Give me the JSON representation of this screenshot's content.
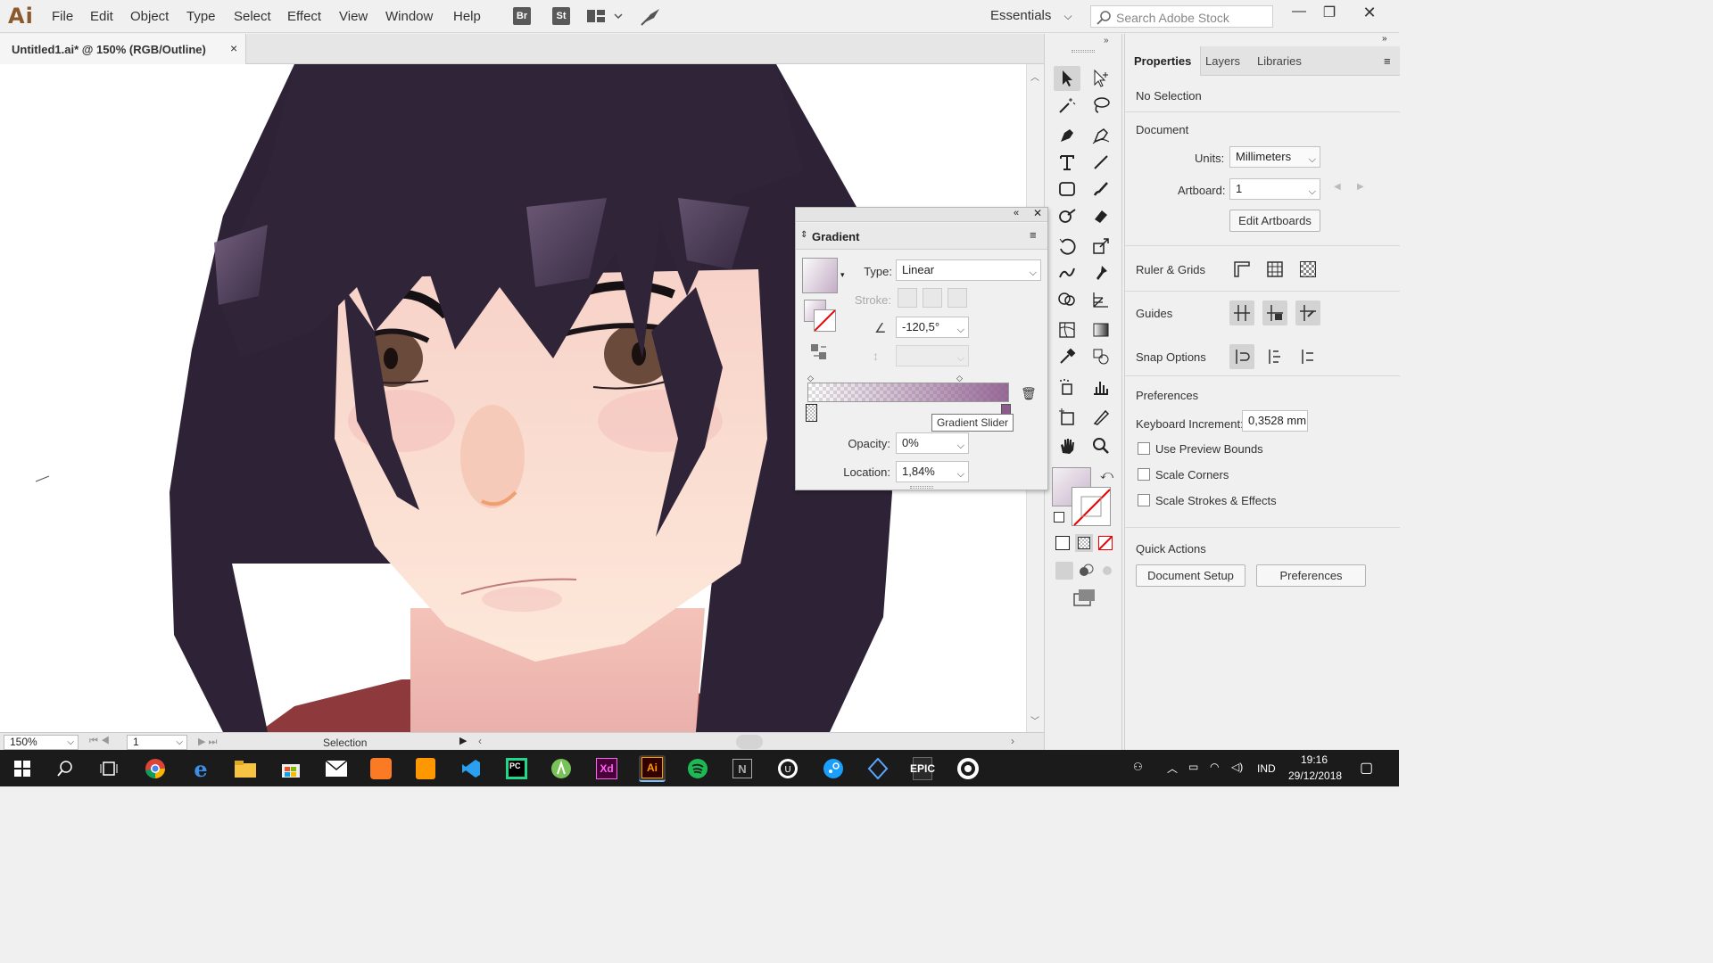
{
  "app": {
    "logo": "Ai",
    "menu": [
      "File",
      "Edit",
      "Object",
      "Type",
      "Select",
      "Effect",
      "View",
      "Window",
      "Help"
    ],
    "bridge_buttons": [
      "Br",
      "St"
    ],
    "workspace": "Essentials",
    "stock_search_placeholder": "Search Adobe Stock"
  },
  "document": {
    "tab_title": "Untitled1.ai* @ 150% (RGB/Outline)",
    "tab_close": "×"
  },
  "statusbar": {
    "zoom": "150%",
    "artboard": "1",
    "tool": "Selection"
  },
  "gradient_panel": {
    "title": "Gradient",
    "type_label": "Type:",
    "type_value": "Linear",
    "stroke_label": "Stroke:",
    "angle_value": "-120,5°",
    "opacity_label": "Opacity:",
    "opacity_value": "0%",
    "location_label": "Location:",
    "location_value": "1,84%",
    "tooltip": "Gradient Slider"
  },
  "properties": {
    "tabs": [
      "Properties",
      "Layers",
      "Libraries"
    ],
    "selection": "No Selection",
    "document_heading": "Document",
    "units_label": "Units:",
    "units_value": "Millimeters",
    "artboard_label": "Artboard:",
    "artboard_value": "1",
    "edit_artboards": "Edit Artboards",
    "ruler_grids": "Ruler & Grids",
    "guides": "Guides",
    "snap_options": "Snap Options",
    "preferences_heading": "Preferences",
    "keyboard_increment_label": "Keyboard Increment:",
    "keyboard_increment_value": "0,3528 mm",
    "checkbox_preview_bounds": "Use Preview Bounds",
    "checkbox_scale_corners": "Scale Corners",
    "checkbox_scale_strokes": "Scale Strokes & Effects",
    "quick_actions": "Quick Actions",
    "document_setup": "Document Setup",
    "preferences_btn": "Preferences"
  },
  "taskbar": {
    "apps": [
      "PC",
      "Xd",
      "Ai",
      "EPIC"
    ],
    "language": "IND",
    "time": "19:16",
    "date": "29/12/2018"
  },
  "colors": {
    "hair": "#2f2438",
    "skin": "#fbe2d2",
    "ai_brand": "#8a5a2c",
    "gradient_end": "#8c5a8c"
  }
}
